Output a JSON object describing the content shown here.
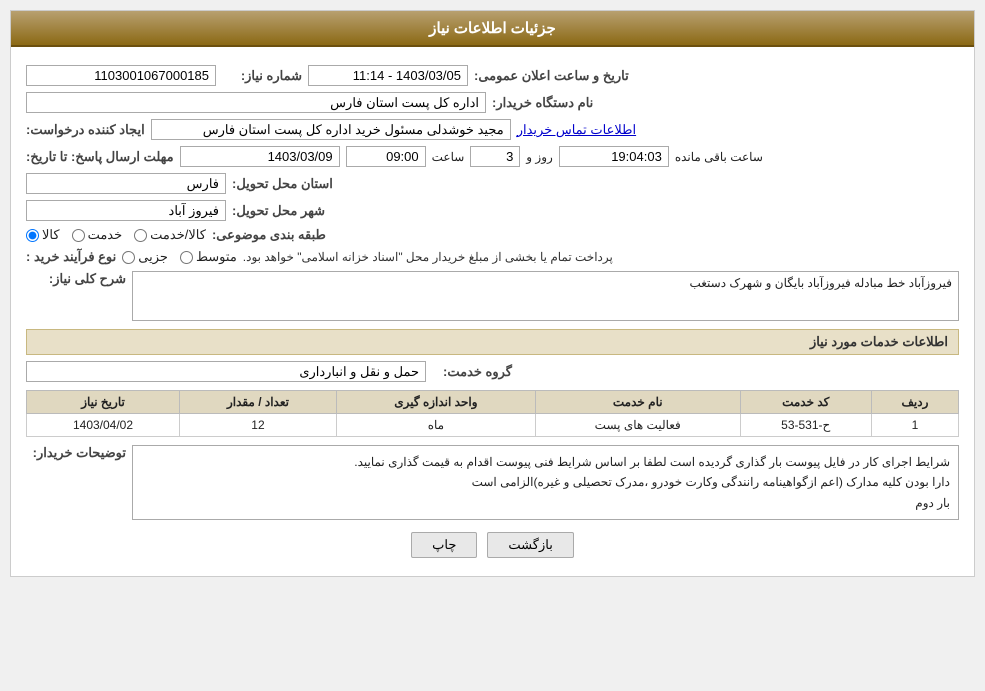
{
  "header": {
    "title": "جزئیات اطلاعات نیاز"
  },
  "fields": {
    "need_number_label": "شماره نیاز:",
    "need_number_value": "1103001067000185",
    "announce_date_label": "تاریخ و ساعت اعلان عمومی:",
    "announce_date_value": "1403/03/05 - 11:14",
    "buyer_org_label": "نام دستگاه خریدار:",
    "buyer_org_value": "اداره کل پست استان فارس",
    "creator_label": "ایجاد کننده درخواست:",
    "creator_name": "مجید خوشدلی مسئول خرید اداره کل پست استان فارس",
    "creator_link": "اطلاعات تماس خریدار",
    "response_deadline_label": "مهلت ارسال پاسخ: تا تاریخ:",
    "response_date": "1403/03/09",
    "response_time_label": "ساعت",
    "response_time": "09:00",
    "response_day_label": "روز و",
    "response_days": "3",
    "response_remain_label": "ساعت باقی مانده",
    "response_remain": "19:04:03",
    "province_label": "استان محل تحویل:",
    "province_value": "فارس",
    "city_label": "شهر محل تحویل:",
    "city_value": "فیروز آباد",
    "category_label": "طبقه بندی موضوعی:",
    "category_options": [
      "کالا",
      "خدمت",
      "کالا/خدمت"
    ],
    "category_selected": "کالا",
    "purchase_type_label": "نوع فرآیند خرید :",
    "purchase_types": [
      "جزیی",
      "متوسط"
    ],
    "purchase_note": "پرداخت تمام یا بخشی از مبلغ خریدار محل \"اسناد خزانه اسلامی\" خواهد بود.",
    "need_desc_label": "شرح کلی نیاز:",
    "need_desc_value": "فیروزآباد خط مبادله فیروزآباد بایگان و شهرک دستغب",
    "services_section": "اطلاعات خدمات مورد نیاز",
    "service_group_label": "گروه خدمت:",
    "service_group_value": "حمل و نقل و انبارداری",
    "table": {
      "headers": [
        "ردیف",
        "کد خدمت",
        "نام خدمت",
        "واحد اندازه گیری",
        "تعداد / مقدار",
        "تاریخ نیاز"
      ],
      "rows": [
        {
          "row": "1",
          "code": "ح-531-53",
          "name": "فعالیت های پست",
          "unit": "ماه",
          "quantity": "12",
          "date": "1403/04/02"
        }
      ]
    },
    "buyer_notes_label": "توضیحات خریدار:",
    "buyer_notes_value": "شرایط اجرای کار در فایل پیوست بار گذاری گردیده است لطفا بر اساس شرایط فنی پیوست اقدام به قیمت گذاری نمایید.\nدارا بودن کلیه مدارک (اعم ازگواهینامه رانندگی وکارت خودرو ،مدرک تحصیلی و غیره)الزامی است\nبار دوم"
  },
  "buttons": {
    "back_label": "بازگشت",
    "print_label": "چاپ"
  }
}
